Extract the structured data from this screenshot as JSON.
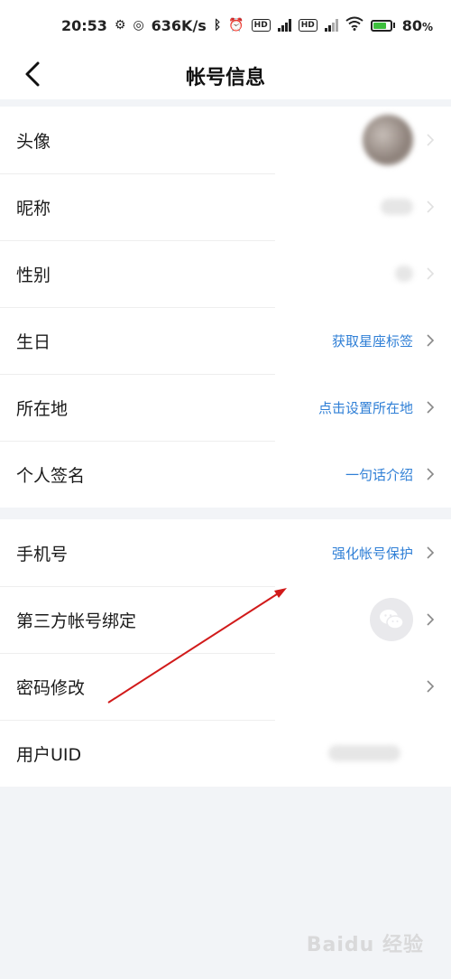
{
  "status_bar": {
    "time": "20:53",
    "speed": "636K/s",
    "battery": "80",
    "battery_unit": "%"
  },
  "header": {
    "title": "帐号信息"
  },
  "group1": {
    "avatar": {
      "label": "头像"
    },
    "nickname": {
      "label": "昵称"
    },
    "gender": {
      "label": "性别"
    },
    "birthday": {
      "label": "生日",
      "value": "获取星座标签"
    },
    "location": {
      "label": "所在地",
      "value": "点击设置所在地"
    },
    "signature": {
      "label": "个人签名",
      "value": "一句话介绍"
    }
  },
  "group2": {
    "phone": {
      "label": "手机号",
      "value": "强化帐号保护"
    },
    "third_party": {
      "label": "第三方帐号绑定"
    },
    "password": {
      "label": "密码修改"
    },
    "uid": {
      "label": "用户UID"
    }
  },
  "watermark": "Baidu 经验",
  "colors": {
    "accent": "#2f7fd6",
    "background": "#f2f4f7",
    "annotation": "#d11a1a"
  }
}
